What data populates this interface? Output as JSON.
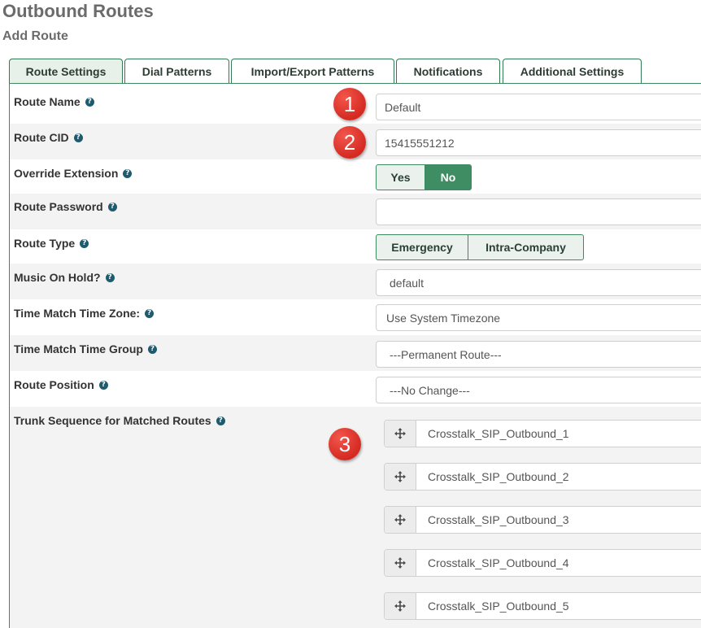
{
  "page": {
    "title": "Outbound Routes",
    "subtitle": "Add Route"
  },
  "tabs": [
    {
      "label": "Route Settings",
      "active": true
    },
    {
      "label": "Dial Patterns"
    },
    {
      "label": "Import/Export Patterns"
    },
    {
      "label": "Notifications"
    },
    {
      "label": "Additional Settings"
    }
  ],
  "help_glyph": "?",
  "form": {
    "route_name": {
      "label": "Route Name",
      "value": "Default"
    },
    "route_cid": {
      "label": "Route CID",
      "value": "15415551212"
    },
    "override_extension": {
      "label": "Override Extension",
      "options": [
        "Yes",
        "No"
      ],
      "selected": "No"
    },
    "route_password": {
      "label": "Route Password",
      "value": ""
    },
    "route_type": {
      "label": "Route Type",
      "options": [
        "Emergency",
        "Intra-Company"
      ]
    },
    "music_on_hold": {
      "label": "Music On Hold?",
      "value": "default"
    },
    "time_zone": {
      "label": "Time Match Time Zone:",
      "value": "Use System Timezone"
    },
    "time_group": {
      "label": "Time Match Time Group",
      "value": "---Permanent Route---"
    },
    "route_position": {
      "label": "Route Position",
      "value": "---No Change---"
    },
    "trunk_sequence": {
      "label": "Trunk Sequence for Matched Routes",
      "trunks": [
        "Crosstalk_SIP_Outbound_1",
        "Crosstalk_SIP_Outbound_2",
        "Crosstalk_SIP_Outbound_3",
        "Crosstalk_SIP_Outbound_4",
        "Crosstalk_SIP_Outbound_5"
      ]
    }
  },
  "markers": [
    "1",
    "2",
    "3"
  ],
  "colors": {
    "accent": "#3e8d63",
    "marker": "#e0342b",
    "help_icon": "#1e5b6e"
  }
}
